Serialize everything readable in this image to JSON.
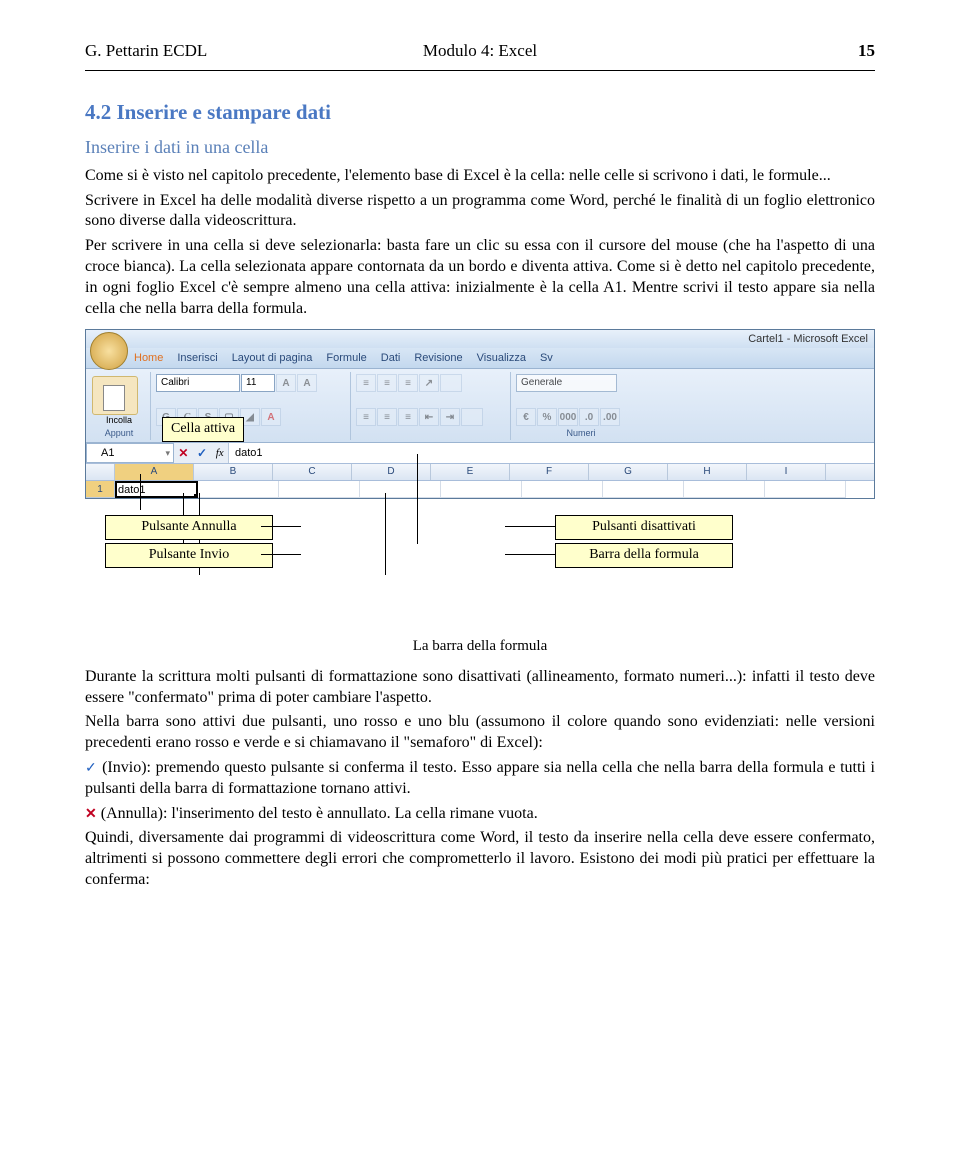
{
  "header": {
    "left": "G. Pettarin ECDL",
    "center": "Modulo 4: Excel",
    "right": "15"
  },
  "section_title": "4.2 Inserire e stampare dati",
  "subsection_title": "Inserire i dati in una cella",
  "para1": "Come si è visto nel capitolo precedente, l'elemento base di Excel è la cella: nelle celle si scrivono i dati, le formule...",
  "para2": "Scrivere in Excel ha delle modalità diverse rispetto a un programma come Word, perché le finalità di un foglio elettronico sono diverse dalla videoscrittura.",
  "para3": "Per scrivere in una cella si deve selezionarla: basta fare un clic su essa con il cursore del mouse (che ha l'aspetto di una croce bianca). La cella selezionata appare contornata da un bordo e diventa attiva. Come si è detto nel capitolo precedente, in ogni foglio Excel c'è sempre almeno una cella attiva: inizialmente è la cella A1. Mentre scrivi il testo appare sia nella cella che nella barra della formula.",
  "excel": {
    "title": "Cartel1 - Microsoft Excel",
    "tabs": [
      "Home",
      "Inserisci",
      "Layout di pagina",
      "Formule",
      "Dati",
      "Revisione",
      "Visualizza",
      "Sv"
    ],
    "font_name": "Calibri",
    "font_size": "11",
    "number_format": "Generale",
    "clipboard_label": "Incolla",
    "groups": {
      "clipboard": "Appunt",
      "font": "",
      "align": "",
      "number": "Numeri"
    },
    "name_box": "A1",
    "fx_value": "dato1",
    "columns": [
      "A",
      "B",
      "C",
      "D",
      "E",
      "F",
      "G",
      "H",
      "I"
    ],
    "row1_label": "1",
    "a1_value": "dato1"
  },
  "callouts": {
    "cella_attiva": "Cella attiva",
    "pulsante_annulla": "Pulsante Annulla",
    "pulsante_invio": "Pulsante Invio",
    "pulsanti_disattivati": "Pulsanti disattivati",
    "barra_formula": "Barra della formula"
  },
  "figure_caption": "La barra della formula",
  "para4": "Durante la scrittura molti pulsanti di formattazione sono disattivati (allineamento, formato numeri...): infatti il testo deve essere \"confermato\" prima di poter cambiare l'aspetto.",
  "para5": "Nella barra sono attivi due pulsanti, uno rosso e uno blu (assumono il colore quando sono evidenziati: nelle versioni precedenti erano rosso e verde e si chiamavano il \"semaforo\" di Excel):",
  "para6": " (Invio): premendo questo pulsante si conferma il testo. Esso appare sia nella cella che nella barra della formula e tutti i pulsanti della barra di formattazione tornano attivi.",
  "para7": " (Annulla): l'inserimento del testo è annullato. La cella rimane vuota.",
  "para8": "Quindi, diversamente dai programmi di videoscrittura come Word, il testo da inserire nella cella deve essere confermato, altrimenti si possono commettere degli errori che comprometterlo il lavoro.  Esistono dei modi più pratici per effettuare la conferma:"
}
